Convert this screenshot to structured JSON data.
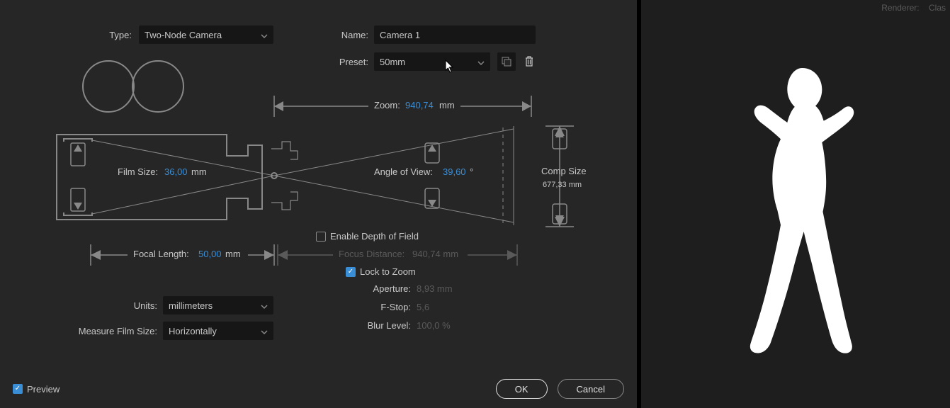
{
  "header": {
    "type_label": "Type:",
    "type_value": "Two-Node Camera",
    "name_label": "Name:",
    "name_value": "Camera 1",
    "preset_label": "Preset:",
    "preset_value": "50mm"
  },
  "diagram": {
    "zoom_label": "Zoom:",
    "zoom_value": "940,74",
    "zoom_unit": "mm",
    "film_size_label": "Film Size:",
    "film_size_value": "36,00",
    "film_size_unit": "mm",
    "angle_label": "Angle of View:",
    "angle_value": "39,60",
    "angle_unit": "°",
    "comp_size_label": "Comp Size",
    "comp_size_value": "677,33 mm",
    "focal_length_label": "Focal Length:",
    "focal_length_value": "50,00",
    "focal_length_unit": "mm"
  },
  "dof": {
    "enable_label": "Enable Depth of Field",
    "enable_checked": false,
    "focus_distance_label": "Focus Distance:",
    "focus_distance_value": "940,74 mm",
    "lock_label": "Lock to Zoom",
    "lock_checked": true,
    "aperture_label": "Aperture:",
    "aperture_value": "8,93 mm",
    "fstop_label": "F-Stop:",
    "fstop_value": "5,6",
    "blur_label": "Blur Level:",
    "blur_value": "100,0 %"
  },
  "units": {
    "units_label": "Units:",
    "units_value": "millimeters",
    "measure_label": "Measure Film Size:",
    "measure_value": "Horizontally"
  },
  "footer": {
    "preview_label": "Preview",
    "preview_checked": true,
    "ok": "OK",
    "cancel": "Cancel"
  },
  "right": {
    "renderer_label": "Renderer:",
    "renderer_value": "Clas"
  }
}
